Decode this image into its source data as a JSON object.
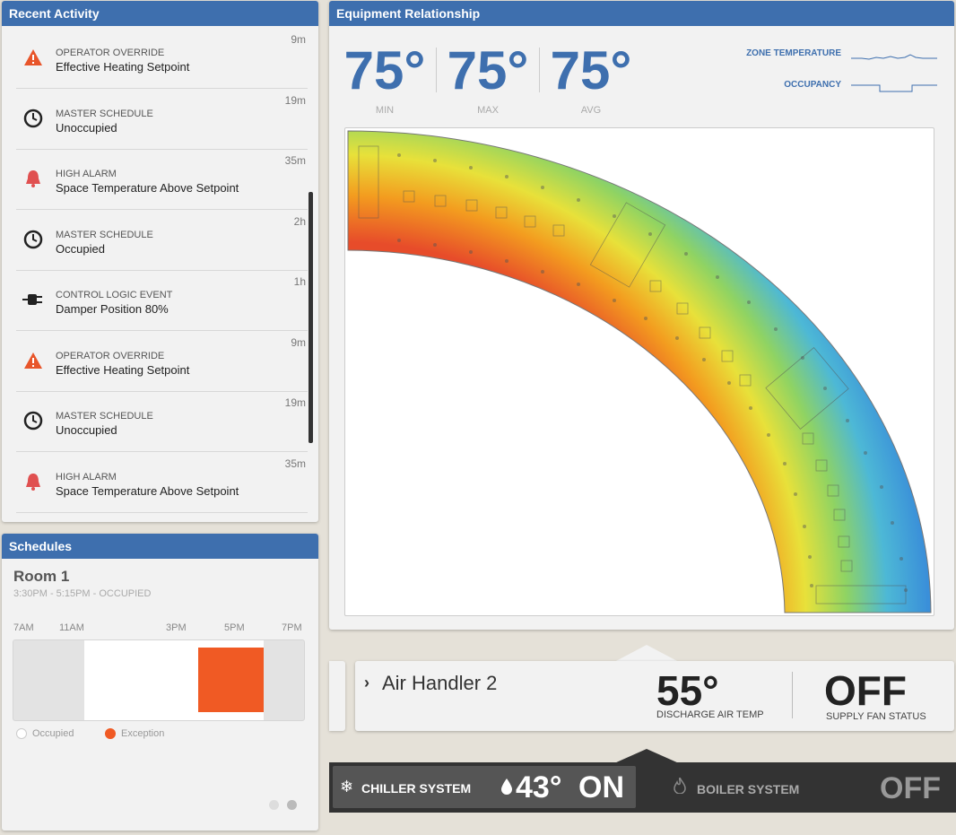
{
  "activity": {
    "title": "Recent Activity",
    "items": [
      {
        "category": "OPERATOR OVERRIDE",
        "description": "Effective Heating Setpoint",
        "time": "9m",
        "icon": "warning-icon"
      },
      {
        "category": "MASTER SCHEDULE",
        "description": "Unoccupied",
        "time": "19m",
        "icon": "clock-icon"
      },
      {
        "category": "HIGH ALARM",
        "description": "Space Temperature Above Setpoint",
        "time": "35m",
        "icon": "bell-icon"
      },
      {
        "category": "MASTER SCHEDULE",
        "description": "Occupied",
        "time": "2h",
        "icon": "clock-icon"
      },
      {
        "category": "CONTROL LOGIC EVENT",
        "description": "Damper Position 80%",
        "time": "1h",
        "icon": "plug-icon"
      },
      {
        "category": "OPERATOR OVERRIDE",
        "description": "Effective Heating Setpoint",
        "time": "9m",
        "icon": "warning-icon"
      },
      {
        "category": "MASTER SCHEDULE",
        "description": "Unoccupied",
        "time": "19m",
        "icon": "clock-icon"
      },
      {
        "category": "HIGH ALARM",
        "description": "Space Temperature Above Setpoint",
        "time": "35m",
        "icon": "bell-icon"
      }
    ]
  },
  "schedules": {
    "title": "Schedules",
    "room": "Room 1",
    "subtitle": "3:30PM - 5:15PM - OCCUPIED",
    "ticks": [
      "7AM",
      "11AM",
      "3PM",
      "5PM",
      "7PM"
    ],
    "legend": {
      "occupied": "Occupied",
      "exception": "Exception"
    },
    "exception_color": "#f05a24"
  },
  "equipment": {
    "title": "Equipment Relationship",
    "stats": [
      {
        "value": "75°",
        "label": "MIN"
      },
      {
        "value": "75°",
        "label": "MAX"
      },
      {
        "value": "75°",
        "label": "AVG"
      }
    ],
    "spark_zone": "ZONE TEMPERATURE",
    "spark_occupancy": "OCCUPANCY"
  },
  "air_handler": {
    "name": "Air Handler 2",
    "discharge_temp": "55°",
    "discharge_label": "DISCHARGE AIR TEMP",
    "fan_status": "OFF",
    "fan_label": "SUPPLY FAN STATUS"
  },
  "systems": {
    "chiller_label": "CHILLER SYSTEM",
    "chiller_temp": "43°",
    "chiller_status": "ON",
    "boiler_label": "BOILER SYSTEM",
    "boiler_status": "OFF"
  },
  "colors": {
    "accent": "#3e6fae",
    "exception": "#f05a24",
    "warning": "#e8552a",
    "alarm": "#e05050"
  }
}
